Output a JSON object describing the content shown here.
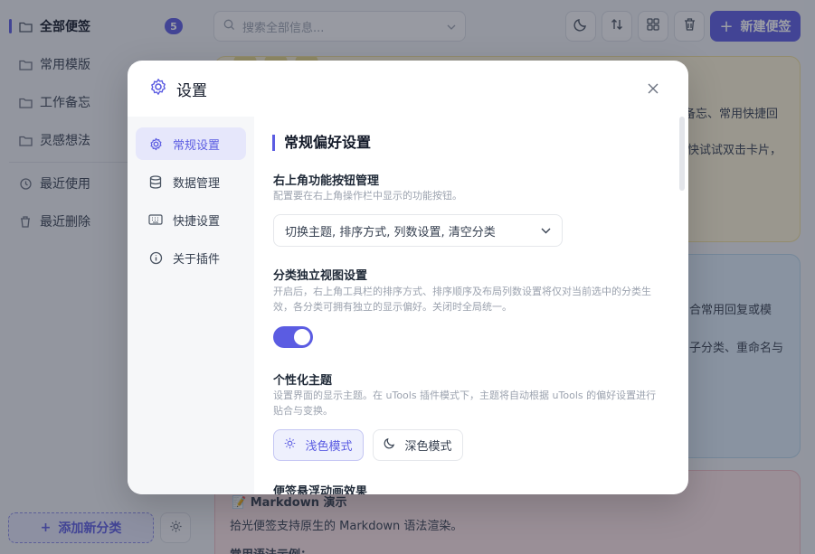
{
  "sidebar": {
    "items": [
      {
        "label": "全部便签",
        "icon": "folder-icon",
        "badge": "5"
      },
      {
        "label": "常用模版",
        "icon": "folder-icon"
      },
      {
        "label": "工作备忘",
        "icon": "folder-icon"
      },
      {
        "label": "灵感想法",
        "icon": "folder-icon"
      },
      {
        "label": "最近使用",
        "icon": "history-icon"
      },
      {
        "label": "最近删除",
        "icon": "trash-icon"
      }
    ],
    "add_category": "添加新分类"
  },
  "toolbar": {
    "search_placeholder": "搜索全部信息...",
    "new_note": "新建便签"
  },
  "cards": {
    "yellow_line1": "备忘、常用快捷回",
    "yellow_line2": "快试试双击卡片，",
    "blue_line1": "合常用回复或模",
    "blue_line2": "子分类、重命名与",
    "pink_title": "Markdown 演示",
    "pink_line1": "拾光便签支持原生的 Markdown 语法渲染。",
    "pink_line2": "常用语法示例："
  },
  "modal": {
    "title": "设置",
    "nav": [
      {
        "label": "常规设置",
        "icon": "gear-icon"
      },
      {
        "label": "数据管理",
        "icon": "database-icon"
      },
      {
        "label": "快捷设置",
        "icon": "keyboard-icon"
      },
      {
        "label": "关于插件",
        "icon": "info-icon"
      }
    ],
    "section_title": "常规偏好设置",
    "buttons_mgmt": {
      "label": "右上角功能按钮管理",
      "desc": "配置要在右上角操作栏中显示的功能按钮。",
      "value": "切换主题, 排序方式, 列数设置, 清空分类"
    },
    "independent_view": {
      "label": "分类独立视图设置",
      "desc": "开启后，右上角工具栏的排序方式、排序顺序及布局列数设置将仅对当前选中的分类生效，各分类可拥有独立的显示偏好。关闭时全局统一。",
      "enabled": true
    },
    "theme": {
      "label": "个性化主题",
      "desc": "设置界面的显示主题。在 uTools 插件模式下，主题将自动根据 uTools 的偏好设置进行贴合与变换。",
      "light": "浅色模式",
      "dark": "深色模式",
      "selected": "浅色模式"
    },
    "hover_anim": {
      "label": "便签悬浮动画效果"
    }
  },
  "colors": {
    "accent": "#5b5ce2",
    "overlay": "rgba(35,40,55,0.45)"
  }
}
